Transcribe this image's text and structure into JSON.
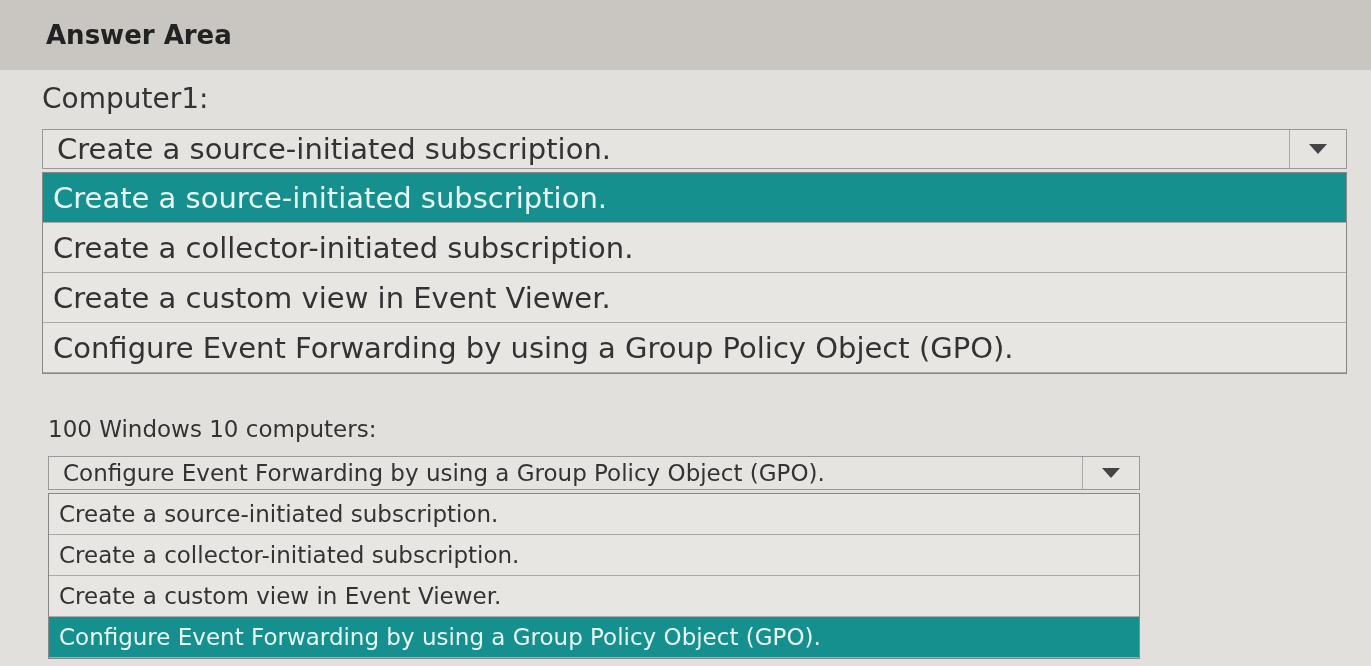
{
  "title": "Answer Area",
  "questions": [
    {
      "label": "Computer1:",
      "kind": "large",
      "value": "Create a source-initiated subscription.",
      "options": [
        {
          "label": "Create a source-initiated subscription.",
          "selected": true
        },
        {
          "label": "Create a collector-initiated subscription.",
          "selected": false
        },
        {
          "label": "Create a custom view in Event Viewer.",
          "selected": false
        },
        {
          "label": "Configure Event Forwarding by using a Group Policy Object (GPO).",
          "selected": false
        }
      ]
    },
    {
      "label": "100 Windows 10 computers:",
      "kind": "small",
      "value": "Configure Event Forwarding by using a Group Policy Object (GPO).",
      "options": [
        {
          "label": "Create a source-initiated subscription.",
          "selected": false
        },
        {
          "label": "Create a collector-initiated subscription.",
          "selected": false
        },
        {
          "label": "Create a custom view in Event Viewer.",
          "selected": false
        },
        {
          "label": "Configure Event Forwarding by using a Group Policy Object (GPO).",
          "selected": true
        }
      ]
    }
  ]
}
